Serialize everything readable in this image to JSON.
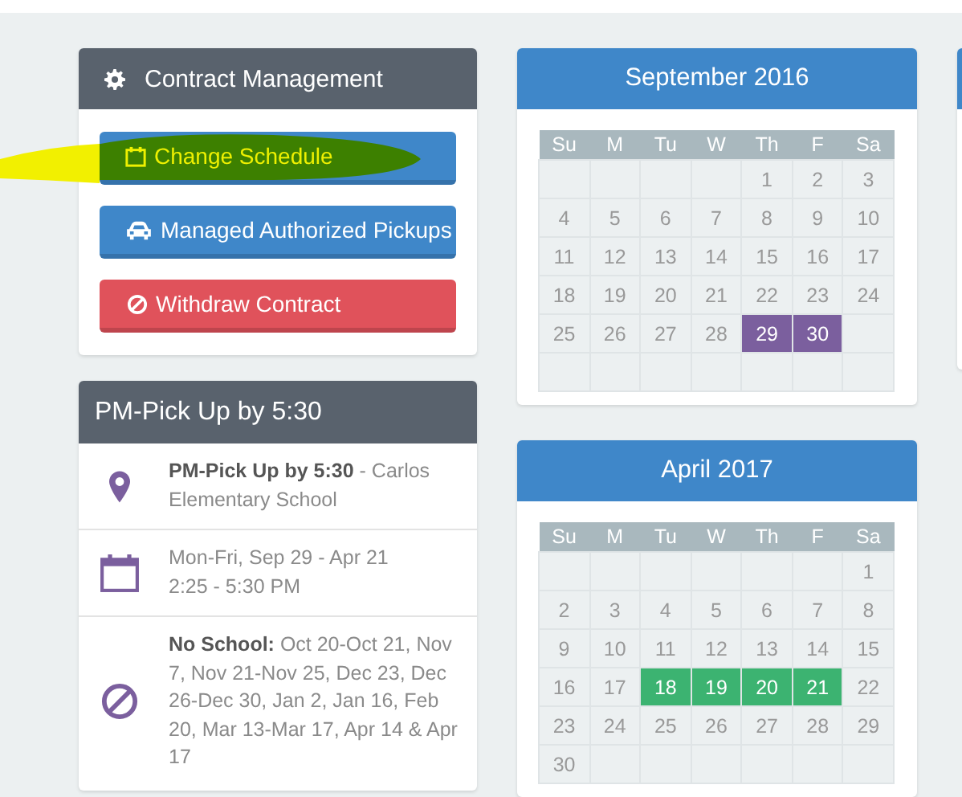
{
  "contract_panel": {
    "title": "Contract Management",
    "buttons": [
      {
        "label": "Change Schedule",
        "kind": "schedule",
        "highlighted": true
      },
      {
        "label": "Managed Authorized Pickups",
        "kind": "pickups",
        "highlighted": false
      },
      {
        "label": "Withdraw Contract",
        "kind": "withdraw",
        "highlighted": false
      }
    ]
  },
  "schedule_panel": {
    "title": "PM-Pick Up by 5:30",
    "items": [
      {
        "kind": "location",
        "lines": [
          "**PM-Pick Up by 5:30** - Carlos Elementary School"
        ]
      },
      {
        "kind": "dates",
        "lines": [
          "Mon-Fri, Sep 29 - Apr 21",
          "2:25 - 5:30 PM"
        ]
      },
      {
        "kind": "closures",
        "lines": [
          "**No School:**  Oct 20-Oct 21, Nov 7, Nov 21-Nov 25, Dec 23, Dec 26-Dec 30, Jan 2, Jan 16, Feb 20, Mar 13-Mar 17, Apr 14 & Apr 17"
        ]
      }
    ]
  },
  "calendars": [
    {
      "title": "September 2016",
      "color": "#7b5f9e",
      "weekdays": [
        "Su",
        "M",
        "Tu",
        "W",
        "Th",
        "F",
        "Sa"
      ],
      "weeks": [
        [
          {
            "kind": "blank"
          },
          {
            "kind": "blank"
          },
          {
            "kind": "blank"
          },
          {
            "kind": "blank"
          },
          {
            "kind": "day",
            "day": "1",
            "selected": false
          },
          {
            "kind": "day",
            "day": "2",
            "selected": false
          },
          {
            "kind": "day",
            "day": "3",
            "selected": false
          }
        ],
        [
          {
            "kind": "day",
            "day": "4",
            "selected": false
          },
          {
            "kind": "day",
            "day": "5",
            "selected": false
          },
          {
            "kind": "day",
            "day": "6",
            "selected": false
          },
          {
            "kind": "day",
            "day": "7",
            "selected": false
          },
          {
            "kind": "day",
            "day": "8",
            "selected": false
          },
          {
            "kind": "day",
            "day": "9",
            "selected": false
          },
          {
            "kind": "day",
            "day": "10",
            "selected": false
          }
        ],
        [
          {
            "kind": "day",
            "day": "11",
            "selected": false
          },
          {
            "kind": "day",
            "day": "12",
            "selected": false
          },
          {
            "kind": "day",
            "day": "13",
            "selected": false
          },
          {
            "kind": "day",
            "day": "14",
            "selected": false
          },
          {
            "kind": "day",
            "day": "15",
            "selected": false
          },
          {
            "kind": "day",
            "day": "16",
            "selected": false
          },
          {
            "kind": "day",
            "day": "17",
            "selected": false
          }
        ],
        [
          {
            "kind": "day",
            "day": "18",
            "selected": false
          },
          {
            "kind": "day",
            "day": "19",
            "selected": false
          },
          {
            "kind": "day",
            "day": "20",
            "selected": false
          },
          {
            "kind": "day",
            "day": "21",
            "selected": false
          },
          {
            "kind": "day",
            "day": "22",
            "selected": false
          },
          {
            "kind": "day",
            "day": "23",
            "selected": false
          },
          {
            "kind": "day",
            "day": "24",
            "selected": false
          }
        ],
        [
          {
            "kind": "day",
            "day": "25",
            "selected": false
          },
          {
            "kind": "day",
            "day": "26",
            "selected": false
          },
          {
            "kind": "day",
            "day": "27",
            "selected": false
          },
          {
            "kind": "day",
            "day": "28",
            "selected": false
          },
          {
            "kind": "day",
            "day": "29",
            "selected": true
          },
          {
            "kind": "day",
            "day": "30",
            "selected": true
          },
          {
            "kind": "blank"
          }
        ],
        [
          {
            "kind": "blank"
          },
          {
            "kind": "blank"
          },
          {
            "kind": "blank"
          },
          {
            "kind": "blank"
          },
          {
            "kind": "blank"
          },
          {
            "kind": "blank"
          },
          {
            "kind": "blank"
          }
        ]
      ]
    },
    {
      "title": "April 2017",
      "color": "#3cb371",
      "weekdays": [
        "Su",
        "M",
        "Tu",
        "W",
        "Th",
        "F",
        "Sa"
      ],
      "weeks": [
        [
          {
            "kind": "blank"
          },
          {
            "kind": "blank"
          },
          {
            "kind": "blank"
          },
          {
            "kind": "blank"
          },
          {
            "kind": "blank"
          },
          {
            "kind": "blank"
          },
          {
            "kind": "day",
            "day": "1",
            "selected": false
          }
        ],
        [
          {
            "kind": "day",
            "day": "2",
            "selected": false
          },
          {
            "kind": "day",
            "day": "3",
            "selected": false
          },
          {
            "kind": "day",
            "day": "4",
            "selected": false
          },
          {
            "kind": "day",
            "day": "5",
            "selected": false
          },
          {
            "kind": "day",
            "day": "6",
            "selected": false
          },
          {
            "kind": "day",
            "day": "7",
            "selected": false
          },
          {
            "kind": "day",
            "day": "8",
            "selected": false
          }
        ],
        [
          {
            "kind": "day",
            "day": "9",
            "selected": false
          },
          {
            "kind": "day",
            "day": "10",
            "selected": false
          },
          {
            "kind": "day",
            "day": "11",
            "selected": false
          },
          {
            "kind": "day",
            "day": "12",
            "selected": false
          },
          {
            "kind": "day",
            "day": "13",
            "selected": false
          },
          {
            "kind": "day",
            "day": "14",
            "selected": false
          },
          {
            "kind": "day",
            "day": "15",
            "selected": false
          }
        ],
        [
          {
            "kind": "day",
            "day": "16",
            "selected": false
          },
          {
            "kind": "day",
            "day": "17",
            "selected": false
          },
          {
            "kind": "day",
            "day": "18",
            "selected": true
          },
          {
            "kind": "day",
            "day": "19",
            "selected": true
          },
          {
            "kind": "day",
            "day": "20",
            "selected": true
          },
          {
            "kind": "day",
            "day": "21",
            "selected": true
          },
          {
            "kind": "day",
            "day": "22",
            "selected": false
          }
        ],
        [
          {
            "kind": "day",
            "day": "23",
            "selected": false
          },
          {
            "kind": "day",
            "day": "24",
            "selected": false
          },
          {
            "kind": "day",
            "day": "25",
            "selected": false
          },
          {
            "kind": "day",
            "day": "26",
            "selected": false
          },
          {
            "kind": "day",
            "day": "27",
            "selected": false
          },
          {
            "kind": "day",
            "day": "28",
            "selected": false
          },
          {
            "kind": "day",
            "day": "29",
            "selected": false
          }
        ],
        [
          {
            "kind": "day",
            "day": "30",
            "selected": false
          },
          {
            "kind": "blank"
          },
          {
            "kind": "blank"
          },
          {
            "kind": "blank"
          },
          {
            "kind": "blank"
          },
          {
            "kind": "blank"
          },
          {
            "kind": "blank"
          }
        ]
      ]
    }
  ]
}
